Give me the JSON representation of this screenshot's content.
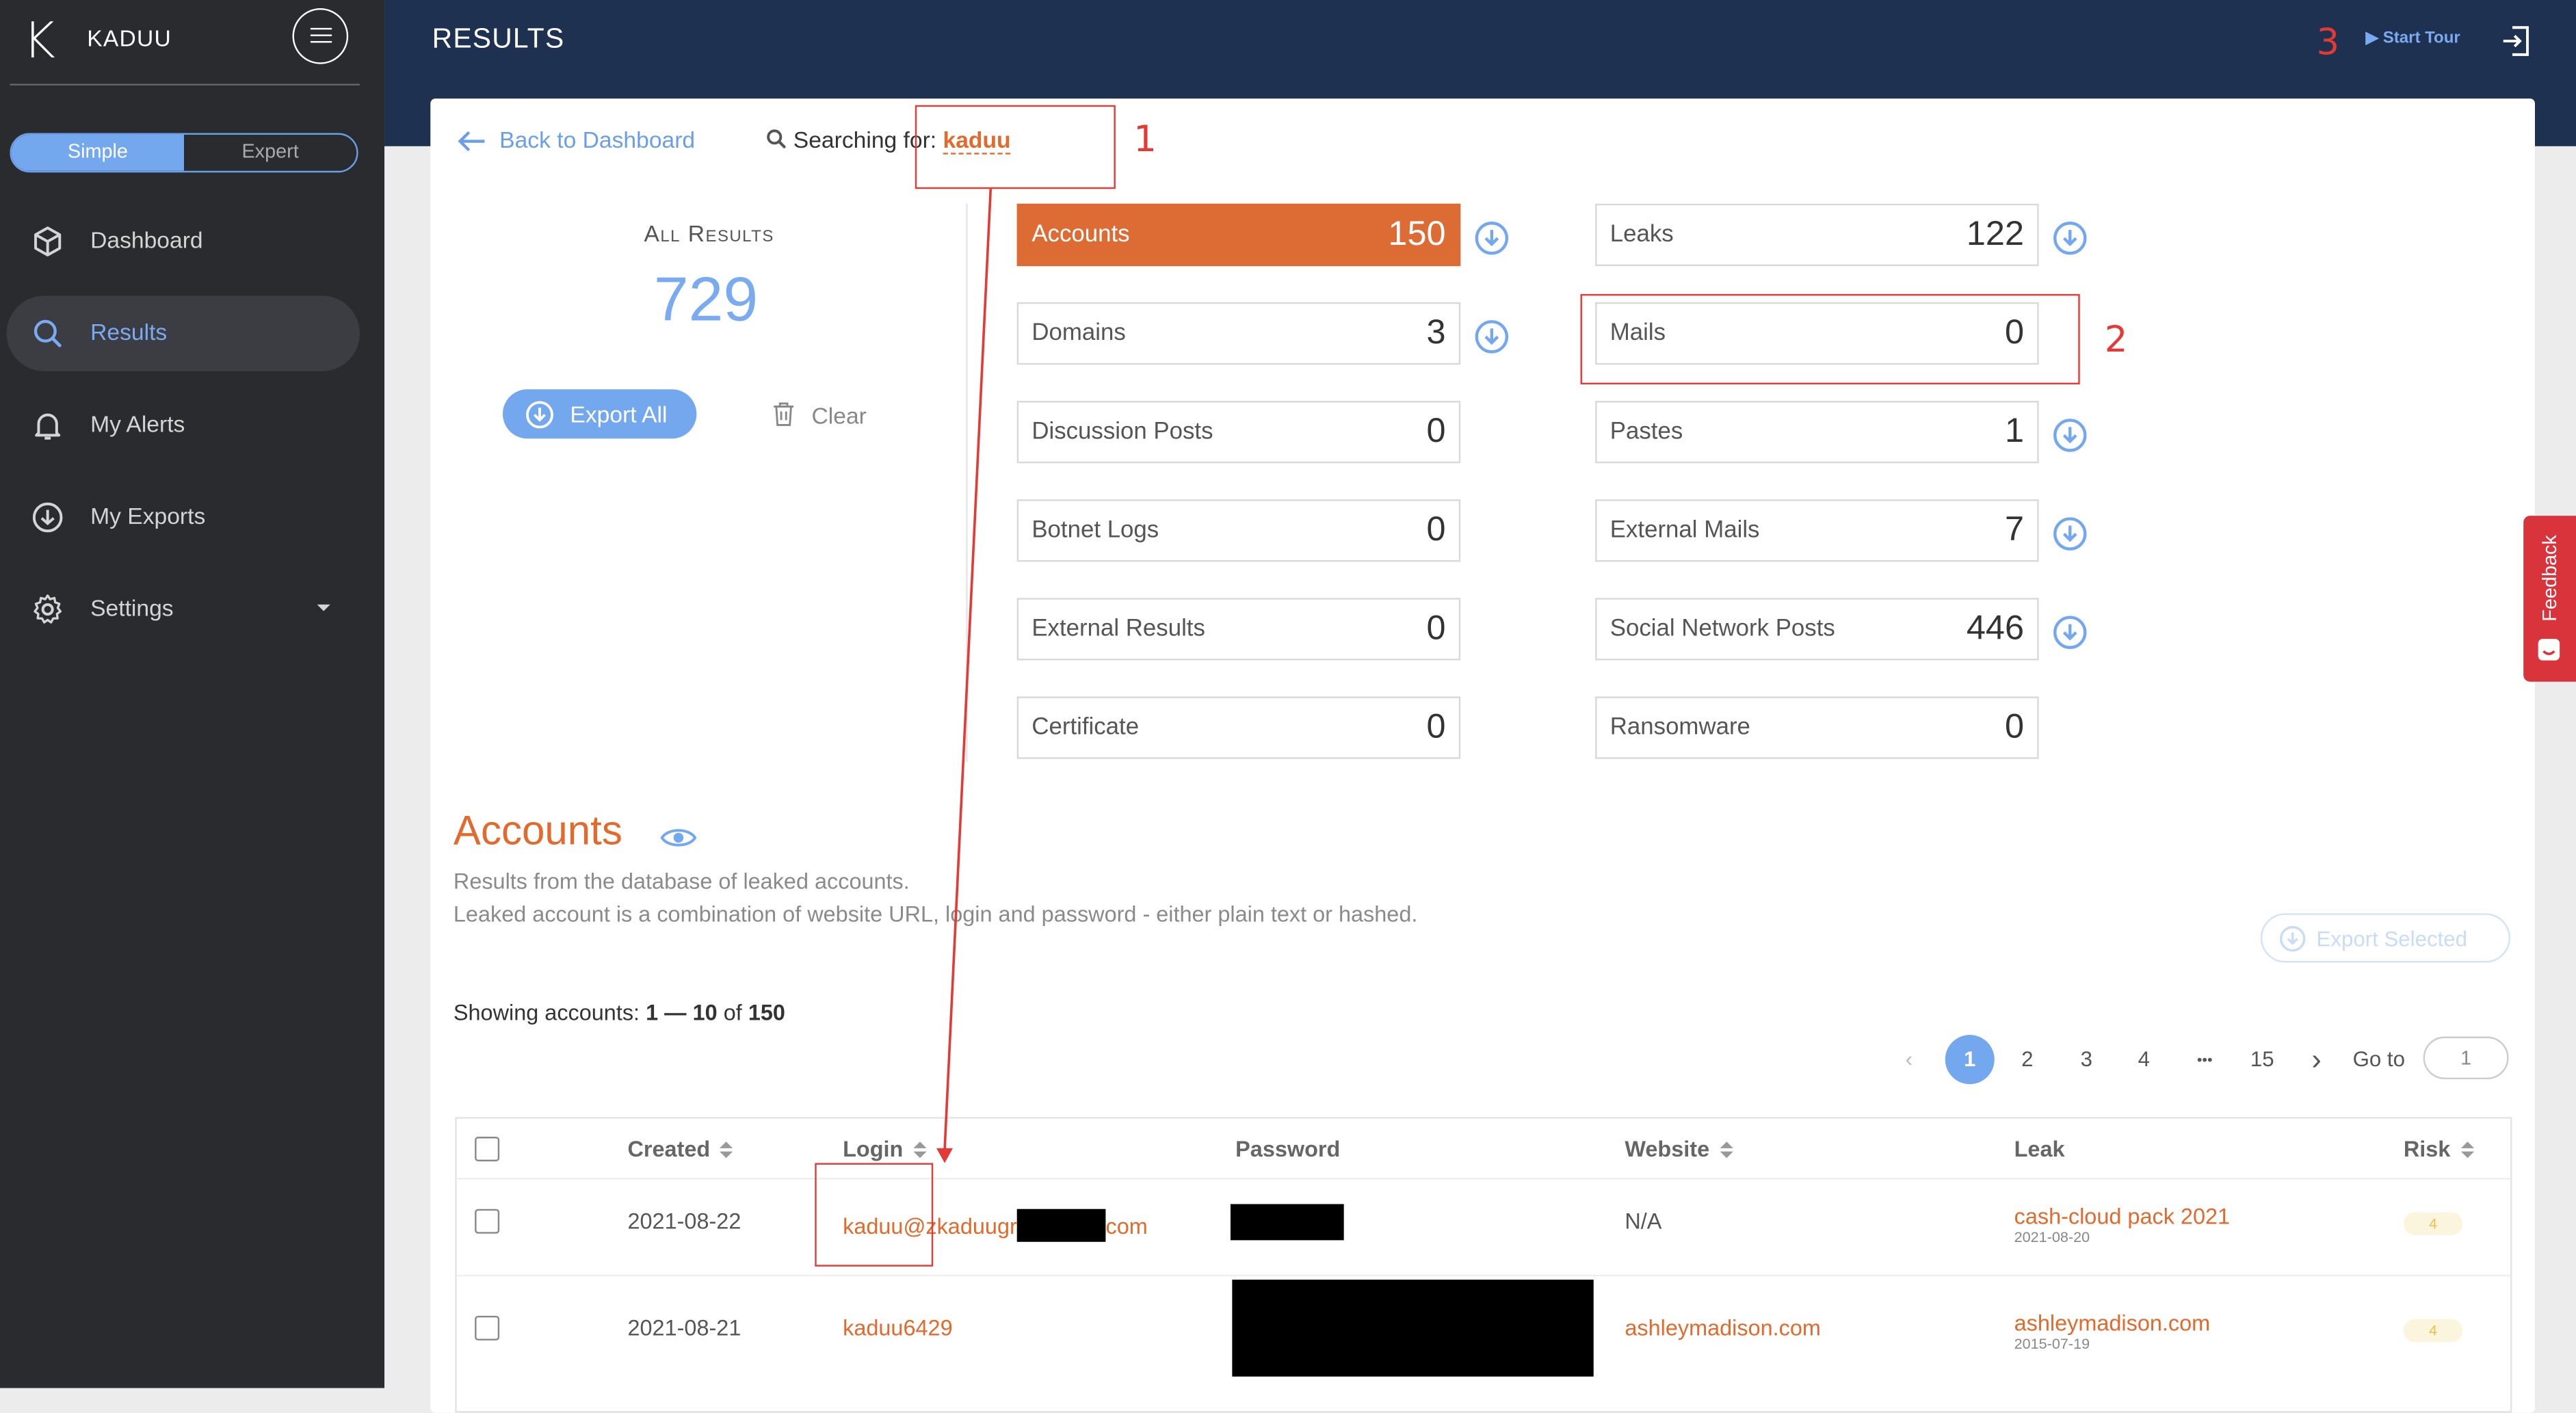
{
  "app": {
    "brand": "KADUU",
    "logo_letter": "K"
  },
  "mode_toggle": {
    "simple": "Simple",
    "expert": "Expert"
  },
  "sidebar": {
    "items": [
      {
        "label": "Dashboard",
        "icon": "cube-icon"
      },
      {
        "label": "Results",
        "icon": "search-icon",
        "active": true
      },
      {
        "label": "My Alerts",
        "icon": "bell-icon"
      },
      {
        "label": "My Exports",
        "icon": "download-circle-icon"
      },
      {
        "label": "Settings",
        "icon": "gear-icon"
      }
    ]
  },
  "header": {
    "title": "RESULTS",
    "start_tour": "▶ Start Tour"
  },
  "annotations": {
    "one": "1",
    "two": "2",
    "three": "3"
  },
  "search": {
    "back": "Back to Dashboard",
    "prefix": "Searching for:",
    "term": "kaduu"
  },
  "summary": {
    "label": "All Results",
    "total": "729",
    "export_all": "Export All",
    "clear": "Clear"
  },
  "categories_left": [
    {
      "label": "Accounts",
      "count": "150",
      "highlighted": true,
      "download": true
    },
    {
      "label": "Domains",
      "count": "3",
      "download": true
    },
    {
      "label": "Discussion Posts",
      "count": "0"
    },
    {
      "label": "Botnet Logs",
      "count": "0"
    },
    {
      "label": "External Results",
      "count": "0"
    },
    {
      "label": "Certificate",
      "count": "0"
    }
  ],
  "categories_right": [
    {
      "label": "Leaks",
      "count": "122",
      "download": true
    },
    {
      "label": "Mails",
      "count": "0"
    },
    {
      "label": "Pastes",
      "count": "1",
      "download": true
    },
    {
      "label": "External Mails",
      "count": "7",
      "download": true
    },
    {
      "label": "Social Network Posts",
      "count": "446",
      "download": true
    },
    {
      "label": "Ransomware",
      "count": "0"
    }
  ],
  "accounts": {
    "title": "Accounts",
    "desc_1": "Results from the database of leaked accounts.",
    "desc_2": "Leaked account is a combination of website URL, login and password - either plain text or hashed.",
    "export_selected": "Export Selected",
    "showing_prefix": "Showing accounts:",
    "showing_range": "1 — 10",
    "showing_of": "of",
    "showing_total": "150"
  },
  "pagination": {
    "pages": [
      "1",
      "2",
      "3",
      "4",
      "•••",
      "15"
    ],
    "current": "1",
    "goto_label": "Go to",
    "goto_value": "1"
  },
  "table": {
    "headers": {
      "created": "Created",
      "login": "Login",
      "password": "Password",
      "website": "Website",
      "leak": "Leak",
      "risk": "Risk"
    },
    "rows": [
      {
        "created": "2021-08-22",
        "login_a": "kaduu@zkaduugr",
        "login_b": "com",
        "website": "N/A",
        "leak": "cash-cloud pack 2021",
        "leak_date": "2021-08-20",
        "risk": "4"
      },
      {
        "created": "2021-08-21",
        "login_a": "kaduu6429",
        "login_b": "",
        "website": "ashleymadison.com",
        "leak": "ashleymadison.com",
        "leak_date": "2015-07-19",
        "risk": "4"
      }
    ]
  },
  "feedback": {
    "label": "Feedback"
  },
  "colors": {
    "sidebar": "#292b2f",
    "header": "#1e3150",
    "accent_blue": "#74a8ee",
    "accent_orange": "#dd6b34",
    "annotation_red": "#e53935"
  }
}
